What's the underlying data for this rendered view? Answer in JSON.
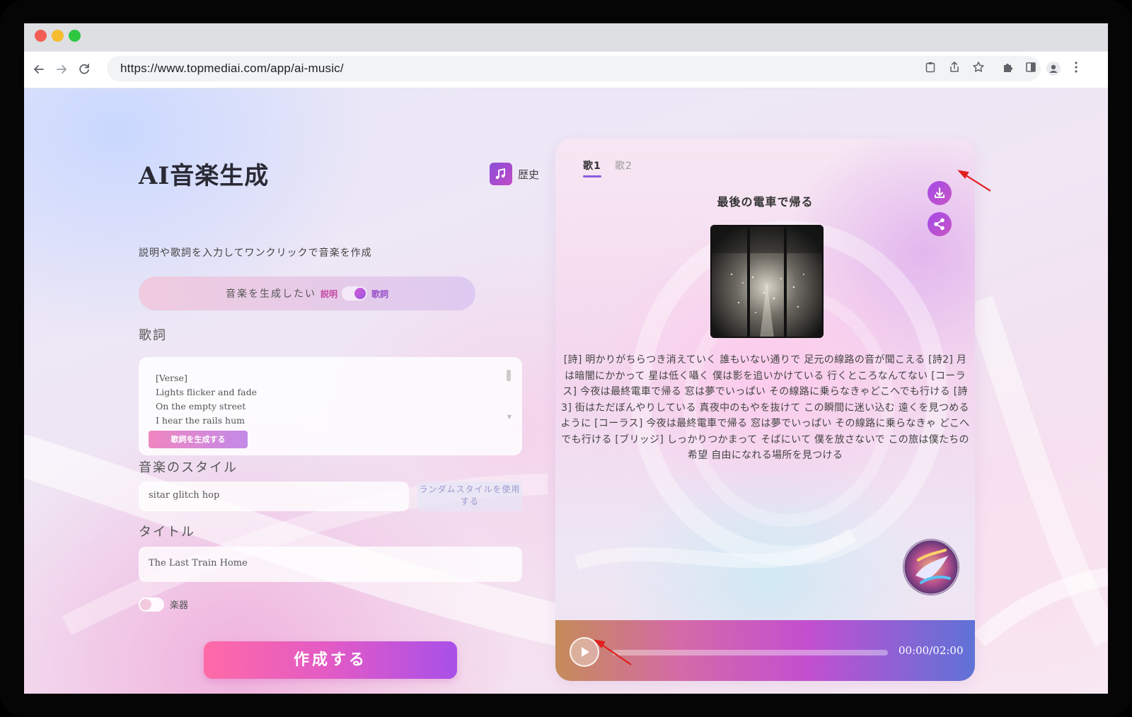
{
  "browser": {
    "url": "https://www.topmediai.com/app/ai-music/"
  },
  "app": {
    "title": "AI音楽生成",
    "history_label": "歴史",
    "subtitle": "説明や歌詞を入力してワンクリックで音楽を作成",
    "mode_prompt": "音楽を生成したい",
    "mode_option_description": "説明",
    "mode_option_lyrics": "歌詞",
    "mode_selected": "歌詞"
  },
  "lyrics": {
    "label": "歌詞",
    "lines": [
      "[Verse]",
      "Lights flicker and fade",
      "On the empty street",
      "I hear the rails hum"
    ],
    "generate_button": "歌詞を生成する"
  },
  "style": {
    "label": "音楽のスタイル",
    "value": "sitar glitch hop",
    "random_button": "ランダムスタイルを使用する"
  },
  "title_field": {
    "label": "タイトル",
    "value": "The Last Train Home"
  },
  "instrumental": {
    "label": "楽器",
    "enabled": false
  },
  "create_button": "作成する",
  "player": {
    "tabs": [
      "歌1",
      "歌2"
    ],
    "active_tab": 0,
    "song_title": "最後の電車で帰る",
    "lyrics": "[詩] 明かりがちらつき消えていく 誰もいない通りで 足元の線路の音が聞こえる [詩2] 月は暗闇にかかって 星は低く囁く 僕は影を追いかけている 行くところなんてない [コーラス] 今夜は最終電車で帰る 窓は夢でいっぱい その線路に乗らなきゃどこへでも行ける [詩3] 街はただぼんやりしている 真夜中のもやを抜けて この瞬間に迷い込む 遠くを見つめるように [コーラス] 今夜は最終電車で帰る 窓は夢でいっぱい その線路に乗らなきゃ どこへでも行ける [ブリッジ] しっかりつかまって そばにいて 僕を放さないで この旅は僕たちの希望 自由になれる場所を見つける",
    "time": "00:00/02:00",
    "progress": 0
  },
  "colors": {
    "accent_purple": "#a24be8",
    "create_gradient_start": "#ff6aa6",
    "create_gradient_end": "#a850e8",
    "annotation_arrow": "#e02020"
  }
}
